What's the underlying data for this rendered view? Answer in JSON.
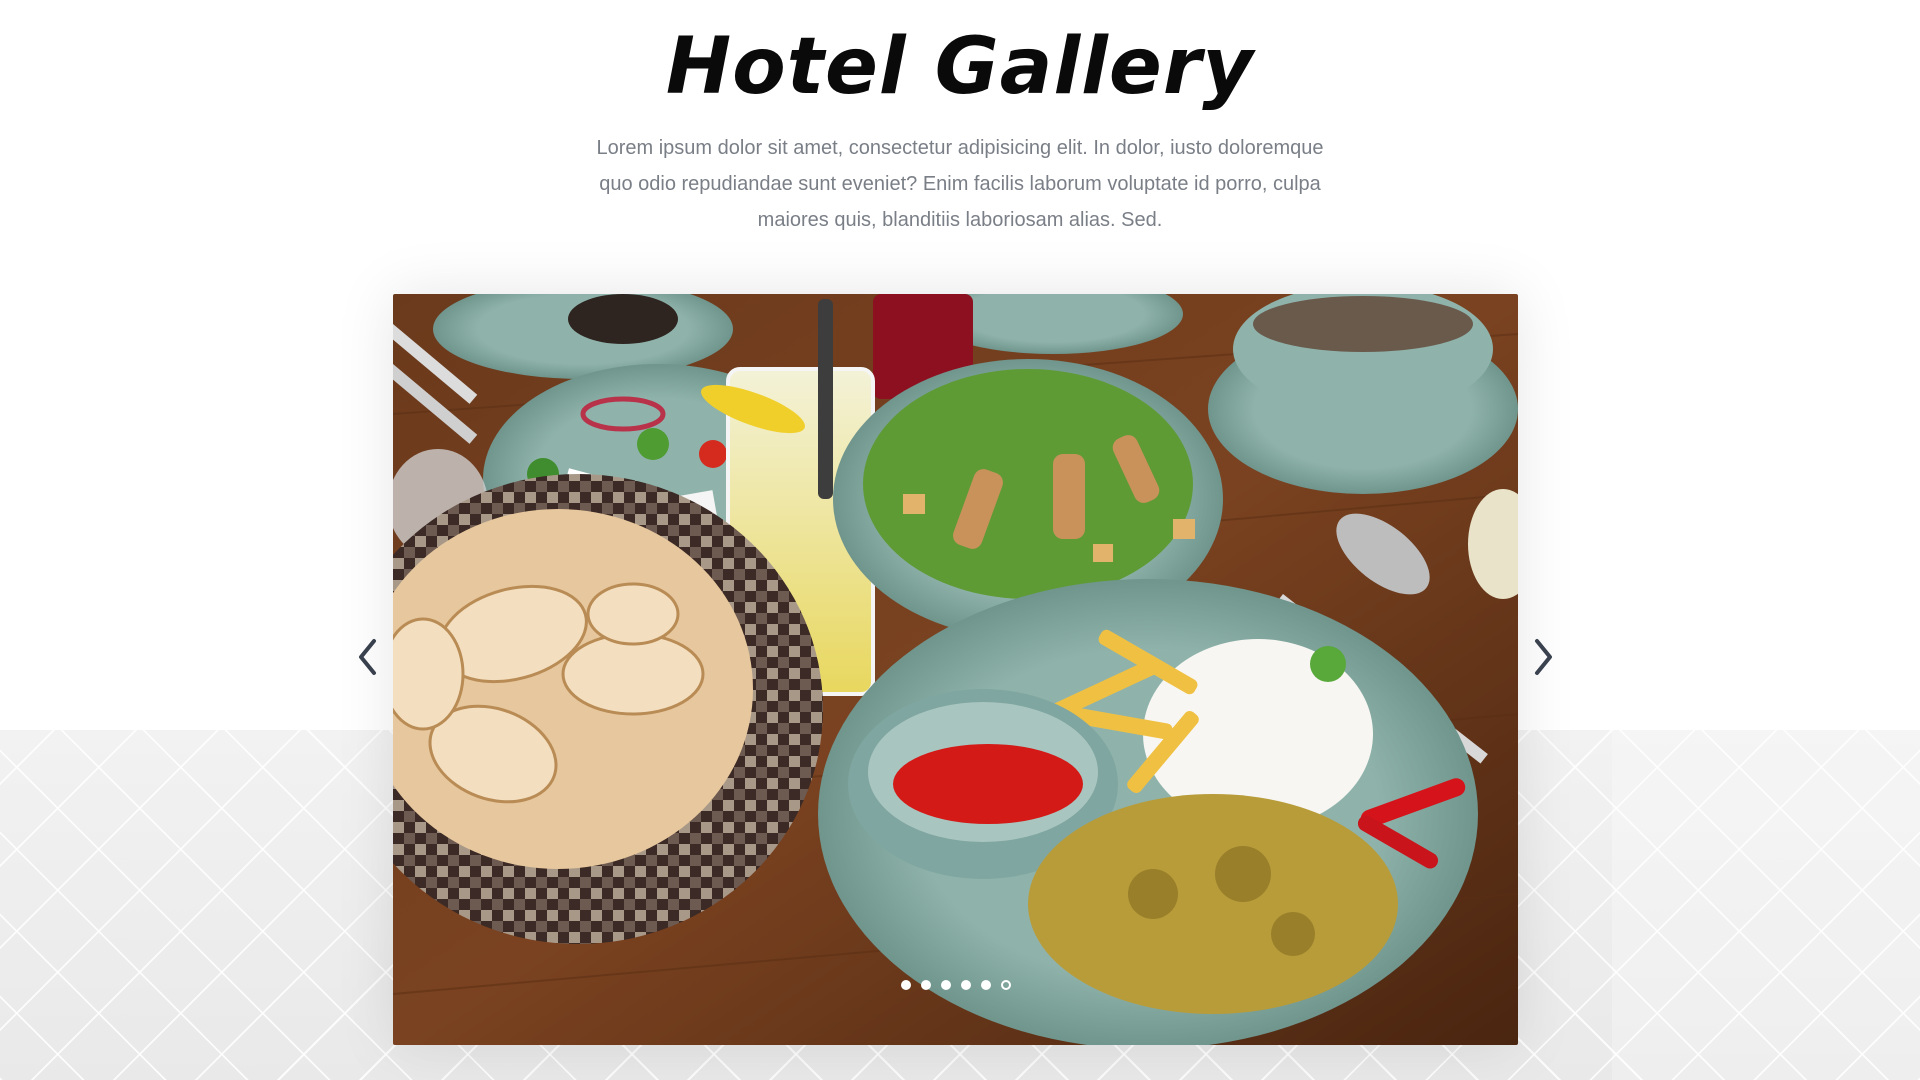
{
  "header": {
    "title": "Hotel Gallery",
    "description": "Lorem ipsum dolor sit amet, consectetur adipisicing elit. In dolor, iusto doloremque quo odio repudiandae sunt eveniet? Enim facilis laborum voluptate id porro, culpa maiores quis, blanditiis laboriosam alias. Sed."
  },
  "carousel": {
    "slide_count": 6,
    "active_index": 5,
    "current_slide": "food-table-photo",
    "prev_icon": "chevron-left-icon",
    "next_icon": "chevron-right-icon"
  },
  "colors": {
    "title": "#0a0a0a",
    "description": "#7a7f87",
    "arrow": "#3a4250",
    "dot": "#ffffff",
    "pattern": "#efefef"
  }
}
